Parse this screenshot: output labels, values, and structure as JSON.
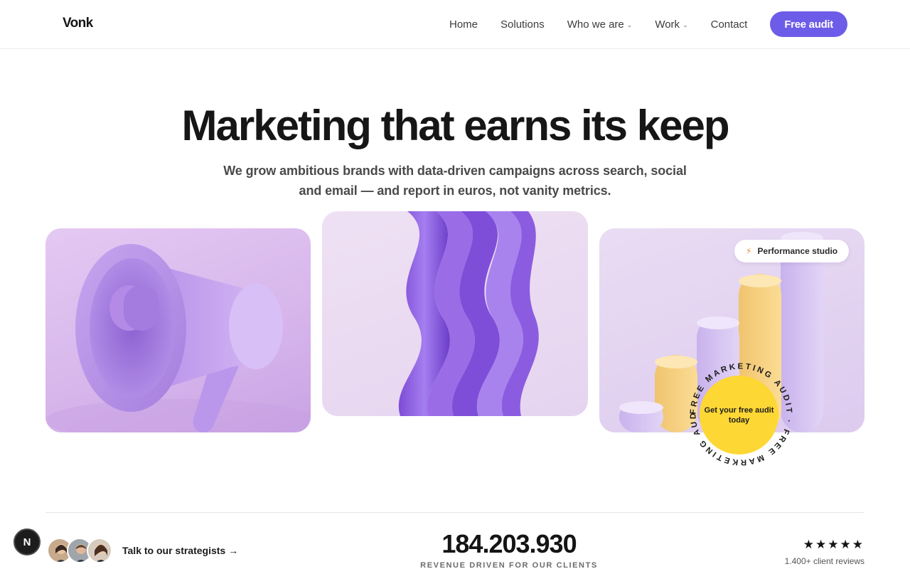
{
  "header": {
    "logo": "Vonk",
    "nav": [
      {
        "label": "Home",
        "dropdown": false
      },
      {
        "label": "Solutions",
        "dropdown": false
      },
      {
        "label": "Who we are",
        "dropdown": true
      },
      {
        "label": "Work",
        "dropdown": true
      },
      {
        "label": "Contact",
        "dropdown": false
      }
    ],
    "cta_label": "Free audit",
    "cta_color": "#6d5ce7"
  },
  "hero": {
    "title": "Marketing that earns its keep",
    "subtitle_line1": "We grow ambitious brands with data-driven campaigns across search, social",
    "subtitle_line2": "and email — and report in euros, not vanity metrics."
  },
  "cards": {
    "pill_label": "Performance studio",
    "pill_icon": "bolt-icon",
    "badge_ring_text": "FREE MARKETING AUDIT · FREE MARKETING AUDIT ·",
    "badge_line1": "Get your free audit",
    "badge_line2": "today",
    "badge_color": "#fdd734"
  },
  "stats": {
    "talk_label": "Talk to our strategists →",
    "number": "184.203.930",
    "number_label": "REVENUE DRIVEN FOR OUR CLIENTS",
    "stars": "★★★★★",
    "reviews": "1.400+ client reviews"
  },
  "fab": {
    "label": "N"
  }
}
